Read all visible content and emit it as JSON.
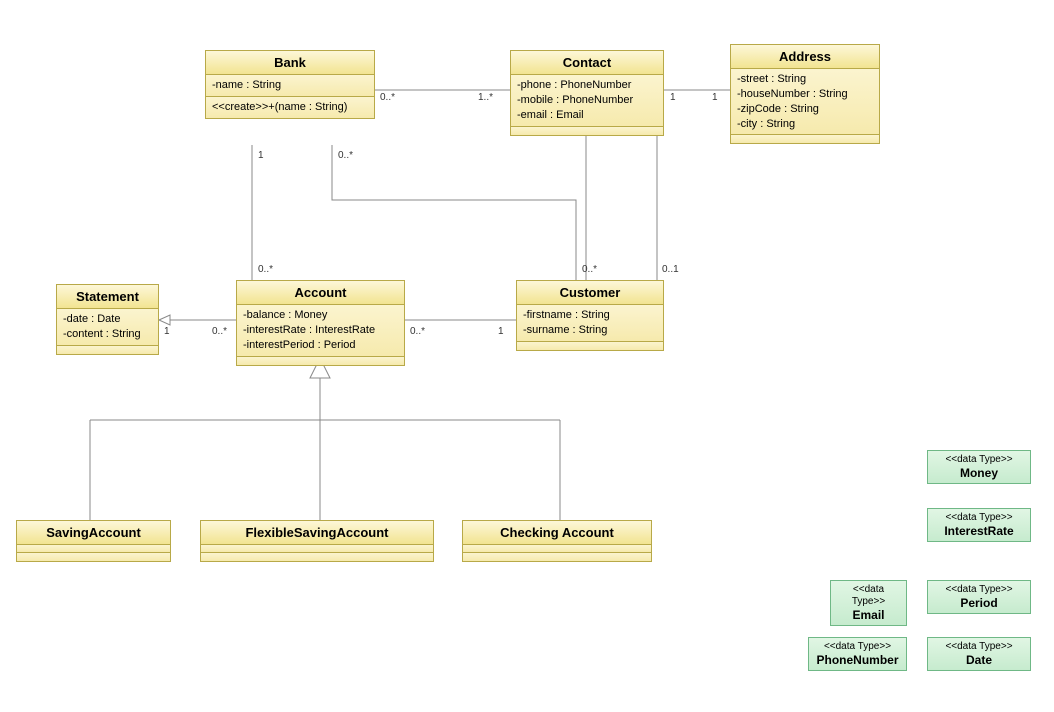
{
  "classes": {
    "bank": {
      "name": "Bank",
      "attrs": [
        "-name : String"
      ],
      "ops": [
        "<<create>>+(name : String)"
      ]
    },
    "contact": {
      "name": "Contact",
      "attrs": [
        "-phone : PhoneNumber",
        "-mobile : PhoneNumber",
        "-email : Email"
      ]
    },
    "address": {
      "name": "Address",
      "attrs": [
        "-street : String",
        "-houseNumber : String",
        "-zipCode : String",
        "-city : String"
      ]
    },
    "statement": {
      "name": "Statement",
      "attrs": [
        "-date : Date",
        "-content : String"
      ]
    },
    "account": {
      "name": "Account",
      "attrs": [
        "-balance : Money",
        "-interestRate : InterestRate",
        "-interestPeriod : Period"
      ]
    },
    "customer": {
      "name": "Customer",
      "attrs": [
        "-firstname : String",
        "-surname : String"
      ]
    },
    "saving": {
      "name": "SavingAccount"
    },
    "flexible": {
      "name": "FlexibleSavingAccount"
    },
    "checking": {
      "name": "Checking Account"
    }
  },
  "datatypes": {
    "money": {
      "stereo": "<<data Type>>",
      "name": "Money"
    },
    "interest": {
      "stereo": "<<data Type>>",
      "name": "InterestRate"
    },
    "email": {
      "stereo": "<<data Type>>",
      "name": "Email"
    },
    "period": {
      "stereo": "<<data Type>>",
      "name": "Period"
    },
    "phone": {
      "stereo": "<<data Type>>",
      "name": "PhoneNumber"
    },
    "date": {
      "stereo": "<<data Type>>",
      "name": "Date"
    }
  },
  "mults": {
    "bank_contact_l": "0..*",
    "bank_contact_r": "1..*",
    "contact_addr_l": "1",
    "contact_addr_r": "1",
    "bank_acct_t": "1",
    "bank_acct_b": "0..*",
    "bank_cust_t": "0..*",
    "bank_cust_b": "0..*",
    "cust_contact_b": "0..1",
    "stmt_l": "1",
    "stmt_r": "0..*",
    "acct_cust_l": "0..*",
    "acct_cust_r": "1"
  }
}
